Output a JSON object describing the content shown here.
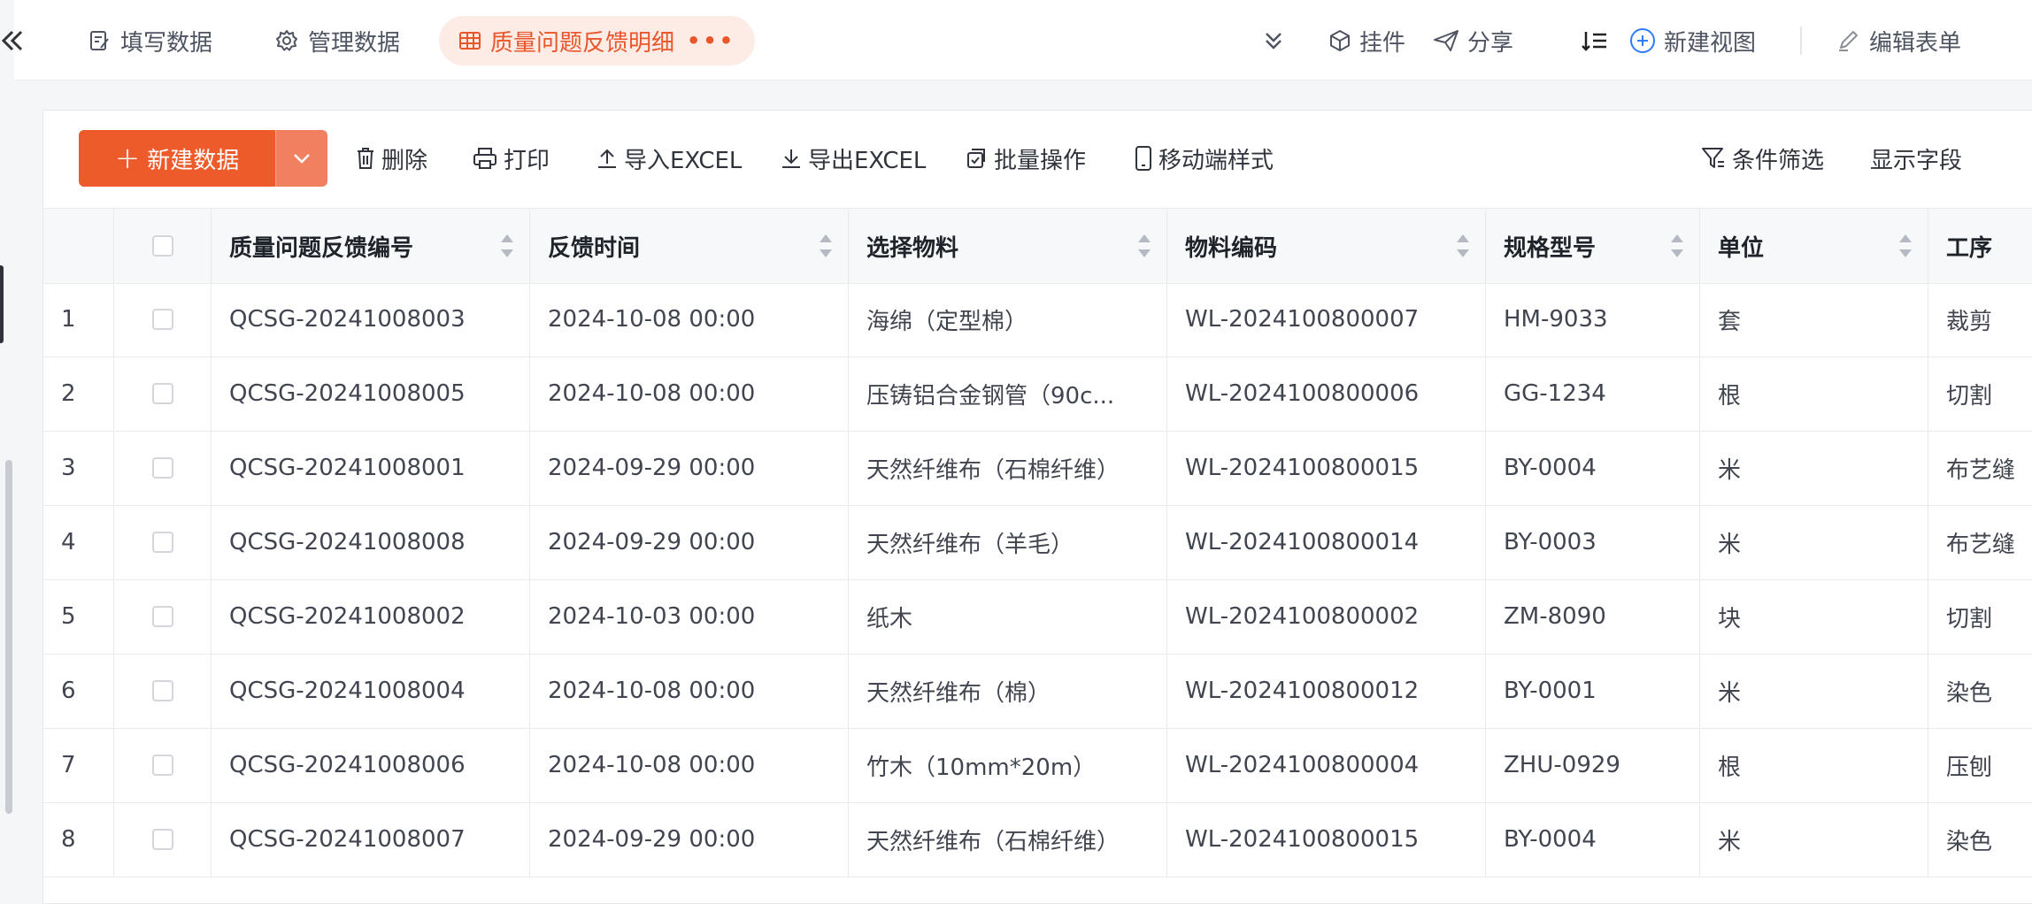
{
  "nav": {
    "tabs": [
      {
        "label": "填写数据",
        "icon": "form-edit-icon"
      },
      {
        "label": "管理数据",
        "icon": "gear-icon"
      },
      {
        "label": "质量问题反馈明细",
        "icon": "table-icon",
        "active": true
      }
    ],
    "actions": {
      "widget": "挂件",
      "share": "分享",
      "new_view": "新建视图",
      "edit_form": "编辑表单"
    },
    "accent_color": "#e8562a"
  },
  "toolbar": {
    "new_data": "新建数据",
    "delete": "删除",
    "print": "打印",
    "import_excel": "导入EXCEL",
    "export_excel": "导出EXCEL",
    "batch": "批量操作",
    "mobile_style": "移动端样式",
    "filter": "条件筛选",
    "show_fields": "显示字段"
  },
  "table": {
    "columns": [
      "质量问题反馈编号",
      "反馈时间",
      "选择物料",
      "物料编码",
      "规格型号",
      "单位",
      "工序"
    ],
    "rows": [
      {
        "idx": "1",
        "code": "QCSG-20241008003",
        "time": "2024-10-08 00:00",
        "material": "海绵（定型棉）",
        "mcode": "WL-2024100800007",
        "spec": "HM-9033",
        "unit": "套",
        "proc": "裁剪"
      },
      {
        "idx": "2",
        "code": "QCSG-20241008005",
        "time": "2024-10-08 00:00",
        "material": "压铸铝合金钢管（90c...",
        "mcode": "WL-2024100800006",
        "spec": "GG-1234",
        "unit": "根",
        "proc": "切割"
      },
      {
        "idx": "3",
        "code": "QCSG-20241008001",
        "time": "2024-09-29 00:00",
        "material": "天然纤维布（石棉纤维）",
        "mcode": "WL-2024100800015",
        "spec": "BY-0004",
        "unit": "米",
        "proc": "布艺缝"
      },
      {
        "idx": "4",
        "code": "QCSG-20241008008",
        "time": "2024-09-29 00:00",
        "material": "天然纤维布（羊毛）",
        "mcode": "WL-2024100800014",
        "spec": "BY-0003",
        "unit": "米",
        "proc": "布艺缝"
      },
      {
        "idx": "5",
        "code": "QCSG-20241008002",
        "time": "2024-10-03 00:00",
        "material": "纸木",
        "mcode": "WL-2024100800002",
        "spec": "ZM-8090",
        "unit": "块",
        "proc": "切割"
      },
      {
        "idx": "6",
        "code": "QCSG-20241008004",
        "time": "2024-10-08 00:00",
        "material": "天然纤维布（棉）",
        "mcode": "WL-2024100800012",
        "spec": "BY-0001",
        "unit": "米",
        "proc": "染色"
      },
      {
        "idx": "7",
        "code": "QCSG-20241008006",
        "time": "2024-10-08 00:00",
        "material": "竹木（10mm*20m）",
        "mcode": "WL-2024100800004",
        "spec": "ZHU-0929",
        "unit": "根",
        "proc": "压刨"
      },
      {
        "idx": "8",
        "code": "QCSG-20241008007",
        "time": "2024-09-29 00:00",
        "material": "天然纤维布（石棉纤维）",
        "mcode": "WL-2024100800015",
        "spec": "BY-0004",
        "unit": "米",
        "proc": "染色"
      }
    ]
  }
}
